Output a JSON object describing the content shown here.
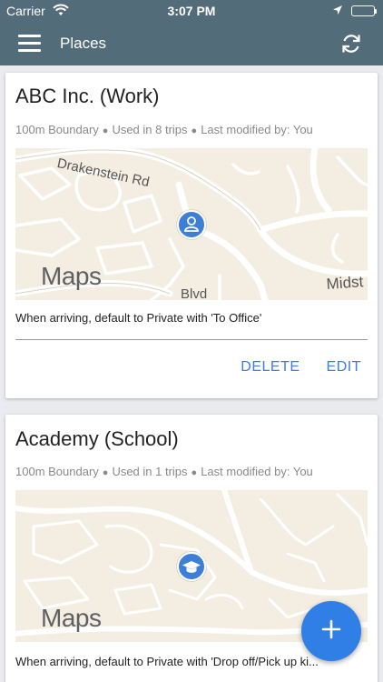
{
  "status_bar": {
    "carrier": "Carrier",
    "time": "3:07 PM",
    "icons": [
      "wifi-icon",
      "location-arrow-icon",
      "battery-icon"
    ]
  },
  "app_bar": {
    "title": "Places",
    "icons": [
      "menu-icon",
      "sync-icon"
    ]
  },
  "places": [
    {
      "name": "ABC Inc. (Work)",
      "boundary": "100m Boundary",
      "trips": "Used in 8 trips",
      "modified": "Last modified by: You",
      "map": {
        "brand": "Maps",
        "road_labels": [
          "Drakenstein Rd",
          "Blvd",
          "Midst"
        ],
        "pin_icon": "person-icon",
        "pin_color": "#3d7fd6"
      },
      "rule": "When arriving, default to Private with 'To Office'",
      "actions": {
        "delete": "DELETE",
        "edit": "EDIT"
      }
    },
    {
      "name": "Academy (School)",
      "boundary": "100m Boundary",
      "trips": "Used in 1 trips",
      "modified": "Last modified by: You",
      "map": {
        "brand": "Maps",
        "pin_icon": "graduation-cap-icon",
        "pin_color": "#3d7fd6"
      },
      "rule": "When arriving, default to Private with 'Drop off/Pick up ki..."
    }
  ],
  "fab": {
    "icon": "plus-icon",
    "color": "#2f7fe6"
  },
  "colors": {
    "app_bar": "#536c79",
    "accent": "#3d7fd6",
    "background": "#e9ebee"
  }
}
